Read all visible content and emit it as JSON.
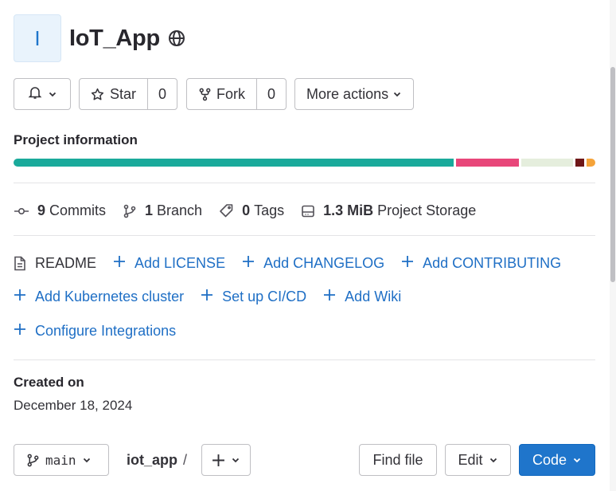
{
  "project": {
    "avatar_letter": "I",
    "name": "IoT_App",
    "visibility_icon": "globe-icon"
  },
  "actions": {
    "notification_icon": "bell-icon",
    "star_label": "Star",
    "star_count": "0",
    "fork_label": "Fork",
    "fork_count": "0",
    "more_label": "More actions"
  },
  "info": {
    "title": "Project information",
    "languages": [
      {
        "color": "#1aaa9b",
        "fraction": 0.77
      },
      {
        "color": "#e8477a",
        "fraction": 0.11
      },
      {
        "color": "#e5eedd",
        "fraction": 0.09
      },
      {
        "color": "#6e1718",
        "fraction": 0.015
      },
      {
        "color": "#f5a33a",
        "fraction": 0.015
      }
    ]
  },
  "stats": {
    "commits_count": "9",
    "commits_label": "Commits",
    "branch_count": "1",
    "branch_label": "Branch",
    "tags_count": "0",
    "tags_label": "Tags",
    "storage_size": "1.3 MiB",
    "storage_label": "Project Storage"
  },
  "links": {
    "readme": "README",
    "license": "Add LICENSE",
    "changelog": "Add CHANGELOG",
    "contributing": "Add CONTRIBUTING",
    "kubernetes": "Add Kubernetes cluster",
    "cicd": "Set up CI/CD",
    "wiki": "Add Wiki",
    "integrations": "Configure Integrations"
  },
  "created": {
    "label": "Created on",
    "date": "December 18, 2024"
  },
  "repo": {
    "branch": "main",
    "path": "iot_app",
    "separator": "/",
    "find_file": "Find file",
    "edit": "Edit",
    "code": "Code",
    "accent": "#1f75cb"
  }
}
